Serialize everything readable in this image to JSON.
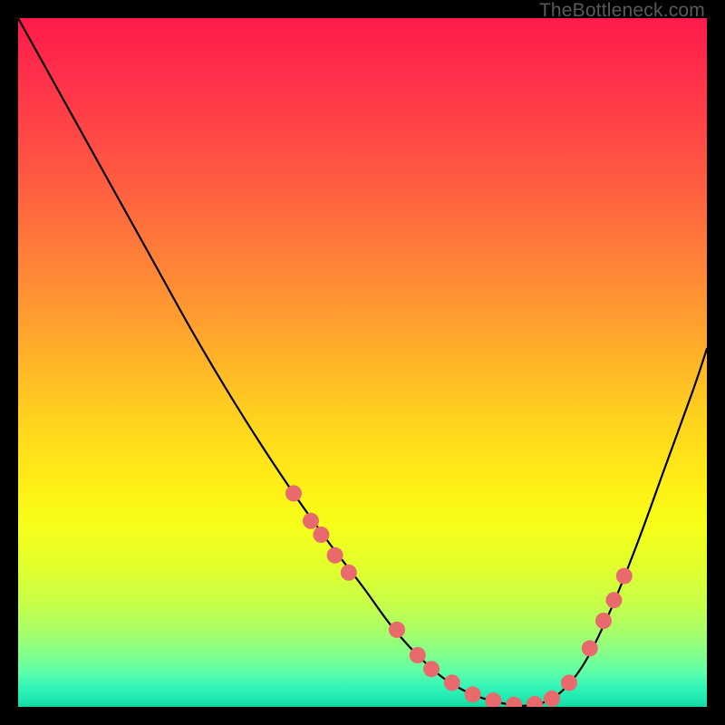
{
  "watermark": "TheBottleneck.com",
  "chart_data": {
    "type": "line",
    "title": "",
    "xlabel": "",
    "ylabel": "",
    "xlim": [
      0,
      100
    ],
    "ylim": [
      0,
      100
    ],
    "grid": false,
    "legend": false,
    "series": [
      {
        "name": "curve",
        "color": "#000000",
        "x": [
          0,
          5,
          10,
          15,
          20,
          25,
          30,
          35,
          40,
          45,
          50,
          54,
          58,
          62,
          66,
          70,
          74,
          78,
          82,
          86,
          90,
          94,
          98,
          100
        ],
        "y": [
          100,
          91,
          82,
          73,
          64,
          55,
          46.5,
          38.5,
          31,
          24,
          17.5,
          12,
          7.5,
          4,
          1.8,
          0.6,
          0.2,
          1.5,
          6,
          14,
          24,
          35,
          46,
          52
        ]
      }
    ],
    "markers": {
      "name": "highlight-dots",
      "color": "#e96a6d",
      "radius": 9,
      "points": [
        {
          "x": 40.0,
          "y": 31.0
        },
        {
          "x": 42.5,
          "y": 27.0
        },
        {
          "x": 44.0,
          "y": 25.0
        },
        {
          "x": 46.0,
          "y": 22.0
        },
        {
          "x": 48.0,
          "y": 19.5
        },
        {
          "x": 55.0,
          "y": 11.2
        },
        {
          "x": 58.0,
          "y": 7.5
        },
        {
          "x": 60.0,
          "y": 5.5
        },
        {
          "x": 63.0,
          "y": 3.5
        },
        {
          "x": 66.0,
          "y": 1.8
        },
        {
          "x": 69.0,
          "y": 0.9
        },
        {
          "x": 72.0,
          "y": 0.3
        },
        {
          "x": 75.0,
          "y": 0.4
        },
        {
          "x": 77.5,
          "y": 1.2
        },
        {
          "x": 80.0,
          "y": 3.5
        },
        {
          "x": 83.0,
          "y": 8.5
        },
        {
          "x": 85.0,
          "y": 12.5
        },
        {
          "x": 86.5,
          "y": 15.5
        },
        {
          "x": 88.0,
          "y": 19.0
        }
      ]
    },
    "background_gradient": {
      "direction": "vertical",
      "stops": [
        {
          "pos": 0.0,
          "color": "#ff1a4b"
        },
        {
          "pos": 0.5,
          "color": "#ffd21e"
        },
        {
          "pos": 0.8,
          "color": "#e0ff2e"
        },
        {
          "pos": 1.0,
          "color": "#17d4a0"
        }
      ]
    }
  }
}
